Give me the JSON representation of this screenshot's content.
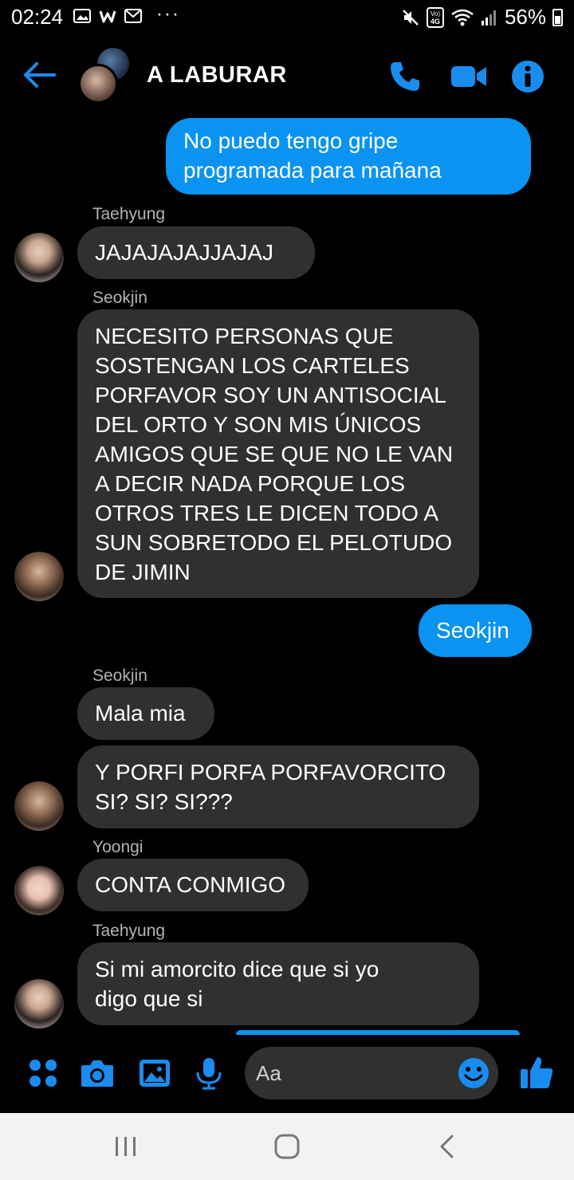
{
  "status_bar": {
    "time": "02:24",
    "battery": "56%",
    "dots": "···",
    "carrier_badge": "Vo) 4G"
  },
  "header": {
    "title": "A LABURAR"
  },
  "messages": [
    {
      "direction": "out",
      "text": "No puedo tengo gripe\nprogramada para mañana"
    },
    {
      "direction": "in",
      "sender": "Taehyung",
      "text": "JAJAJAJAJJAJAJ"
    },
    {
      "direction": "in",
      "sender": "Seokjin",
      "text": "NECESITO PERSONAS QUE\nSOSTENGAN LOS CARTELES\nPORFAVOR SOY UN ANTISOCIAL\nDEL ORTO Y SON MIS ÚNICOS\nAMIGOS QUE SE QUE NO LE VAN\nA DECIR NADA PORQUE LOS\nOTROS TRES LE DICEN TODO A\nSUN SOBRETODO EL PELOTUDO\nDE JIMIN"
    },
    {
      "direction": "out",
      "text": "Seokjin"
    },
    {
      "direction": "in",
      "sender": "Seokjin",
      "text": "Mala mia"
    },
    {
      "direction": "in",
      "text": "Y PORFI PORFA PORFAVORCITO\nSI? SI? SI???"
    },
    {
      "direction": "in",
      "sender": "Yoongi",
      "text": "CONTA CONMIGO"
    },
    {
      "direction": "in",
      "sender": "Taehyung",
      "text": "Si mi amorcito dice que si yo\ndigo que si"
    }
  ],
  "composer": {
    "placeholder": "Aa"
  },
  "colors": {
    "accent": "#0a93f0",
    "incoming_bubble": "#303030",
    "background": "#000000"
  },
  "icons": [
    "back-arrow-icon",
    "phone-icon",
    "video-camera-icon",
    "info-icon",
    "apps-grid-icon",
    "camera-icon",
    "gallery-icon",
    "microphone-icon",
    "emoji-icon",
    "thumbs-up-icon",
    "nav-recent-icon",
    "nav-home-icon",
    "nav-back-icon"
  ]
}
